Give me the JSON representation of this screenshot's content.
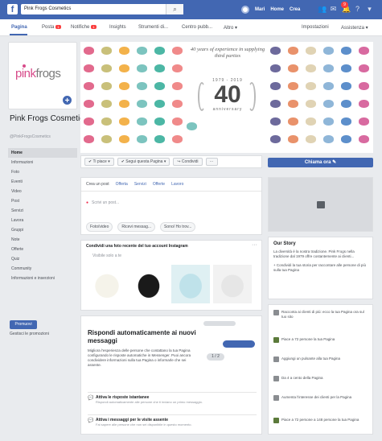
{
  "topbar": {
    "logo": "f",
    "search_value": "Pink Frogs Cosmetics",
    "search_icon": "search-icon",
    "nav": [
      "Mari",
      "Home",
      "Crea"
    ]
  },
  "tabs": [
    {
      "label": "Pagina",
      "new": ""
    },
    {
      "label": "Posta",
      "new": "1"
    },
    {
      "label": "Notifiche",
      "new": "1"
    },
    {
      "label": "Insights",
      "new": ""
    },
    {
      "label": "Strumenti di...",
      "new": ""
    },
    {
      "label": "Centro pubb...",
      "new": ""
    },
    {
      "label": "Altro ▾",
      "new": ""
    },
    {
      "label": "Impostazioni",
      "new": ""
    },
    {
      "label": "Assistenza ▾",
      "new": ""
    }
  ],
  "profile": {
    "logo_pink": "pink",
    "logo_gray": "frogs",
    "name": "Pink Frogs Cosmetics",
    "handle": "@PinkFrogsCosmetics"
  },
  "side_menu": [
    "Home",
    "Informazioni",
    "Foto",
    "Eventi",
    "Video",
    "Post",
    "Servizi",
    "Lavora",
    "Gruppi",
    "Note",
    "Offerte",
    "Quiz",
    "Community",
    "Informazioni e inserzioni"
  ],
  "promote": {
    "button": "Promuovi",
    "manage": "Gestisci le promozioni"
  },
  "cover": {
    "quote": "40 years of experience in supplying third parties",
    "years": "1979 - 2019",
    "number": "40",
    "word": "anniversary",
    "colors": [
      "#e26a8d",
      "#f3b24b",
      "#4cb7a5",
      "#6fc2d8",
      "#b9a6d8",
      "#e9926b",
      "#8fb6d8",
      "#d86aa0",
      "#c9c07a",
      "#7cc4bf",
      "#f08a8a",
      "#a6d1e6",
      "#6d6a9c",
      "#e0d3b4",
      "#5d8fcb"
    ]
  },
  "actions": [
    "✔ Ti piace ▾",
    "✔ Segui questa Pagina ▾",
    "↪ Condividi",
    "···"
  ],
  "message_button": "Chiama ora ✎",
  "composer": {
    "tabs": [
      "Crea un post",
      "Offerta",
      "Servizi",
      "Offerte",
      "Lavoro"
    ],
    "placeholder": "Scrivi un post...",
    "buttons": [
      "Foto/video",
      "Ricevi messag...",
      "Sono/ Ho trov..."
    ]
  },
  "instagram": {
    "title": "Condividi una foto recente del tuo account Instagram",
    "subtitle": "Visibile solo a te",
    "more": "···"
  },
  "auto_reply": {
    "title": "Rispondi automaticamente ai nuovi messaggi",
    "description": "Migliora l'esperienza delle persone che contattano la tua Pagina configurando le risposte automatiche in Messenger. Puoi ancora condividere informazioni sulla tua Pagina o informarle che sei assente.",
    "chip": "1 / 2",
    "options": [
      {
        "title": "Attiva le risposte istantanee",
        "desc": "Rispondi automaticamente alle persone che ti inviano un primo messaggio."
      },
      {
        "title": "Attiva i messaggi per le visite assente",
        "desc": "Fai sapere alle persone che non sei disponibile in questo momento."
      }
    ]
  },
  "story": {
    "heading": "Our Story",
    "text": "La diversità è la nostra tradizione. Pink Frogs nella tradizione dal 1979 offre costantemente ai clienti...",
    "link": "+ Condividi la tua storia per raccontare alle persone di più sulla tua Pagina"
  },
  "feed": [
    "Racconta ai clienti di più: ecco la tua Pagina ora sul tuo sito",
    "Piace a 72 persone la tua Pagina",
    "Aggiungi un pulsante alla tua Pagina",
    "Da 4 a cento della Pagina",
    "Aumenta l'interesse dei clienti per la Pagina",
    "Piace a 72 persone a 148 persone la tua Pagina"
  ]
}
